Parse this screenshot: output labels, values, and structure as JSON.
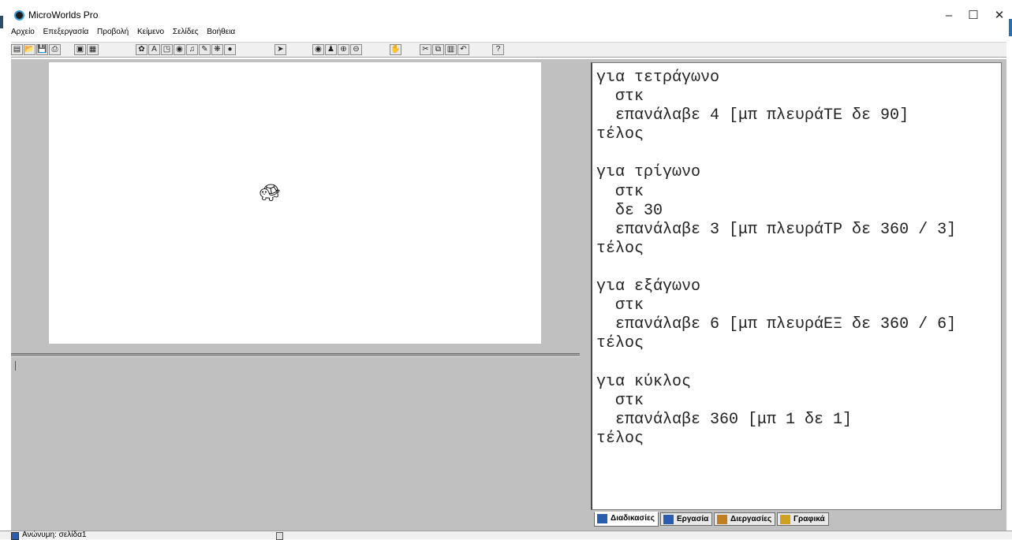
{
  "window": {
    "title": "MicroWorlds Pro",
    "minimize": "–",
    "maximize": "☐",
    "close": "✕"
  },
  "menu": [
    "Αρχείο",
    "Επεξεργασία",
    "Προβολή",
    "Κείμενο",
    "Σελίδες",
    "Βοήθεια"
  ],
  "toolbar": {
    "buttons": [
      {
        "name": "new-page-icon",
        "glyph": "▤"
      },
      {
        "name": "open-icon",
        "glyph": "📂"
      },
      {
        "name": "save-icon",
        "glyph": "💾"
      },
      {
        "name": "print-icon",
        "glyph": "⎙"
      },
      {
        "name": "show-page-icon",
        "glyph": "▣"
      },
      {
        "name": "show-sheet-icon",
        "glyph": "▦"
      },
      {
        "name": "new-turtle-icon",
        "glyph": "✿"
      },
      {
        "name": "text-box-icon",
        "glyph": "A"
      },
      {
        "name": "button-icon",
        "glyph": "◳"
      },
      {
        "name": "eye-icon",
        "glyph": "◉"
      },
      {
        "name": "music-icon",
        "glyph": "♫"
      },
      {
        "name": "paint-icon",
        "glyph": "✎"
      },
      {
        "name": "shapes-icon",
        "glyph": "❋"
      },
      {
        "name": "sound-icon",
        "glyph": "●"
      },
      {
        "name": "pointer-icon",
        "glyph": "➤"
      },
      {
        "name": "eye-tool-icon",
        "glyph": "◉"
      },
      {
        "name": "stamp-icon",
        "glyph": "♟"
      },
      {
        "name": "zoom-in-icon",
        "glyph": "⊕"
      },
      {
        "name": "zoom-out-icon",
        "glyph": "⊖"
      },
      {
        "name": "stop-icon",
        "glyph": "✋"
      },
      {
        "name": "cut-icon",
        "glyph": "✂"
      },
      {
        "name": "copy-icon",
        "glyph": "⧉"
      },
      {
        "name": "paste-icon",
        "glyph": "▥"
      },
      {
        "name": "undo-icon",
        "glyph": "↶"
      },
      {
        "name": "help-icon",
        "glyph": "?"
      }
    ]
  },
  "procedures": {
    "lines": [
      "για τετράγωνο",
      "  στκ",
      "  επανάλαβε 4 [μπ πλευράΤΕ δε 90]",
      "τέλος",
      "",
      "για τρίγωνο",
      "  στκ",
      "  δε 30",
      "  επανάλαβε 3 [μπ πλευράΤΡ δε 360 / 3]",
      "τέλος",
      "",
      "για εξάγωνο",
      "  στκ",
      "  επανάλαβε 6 [μπ πλευράΕΞ δε 360 / 6]",
      "τέλος",
      "",
      "για κύκλος",
      "  στκ",
      "  επανάλαβε 360 [μπ 1 δε 1]",
      "τέλος"
    ]
  },
  "tabs": [
    {
      "label": "Διαδικασίες",
      "icon": "procedures-icon",
      "active": true
    },
    {
      "label": "Εργασία",
      "icon": "project-icon",
      "active": false
    },
    {
      "label": "Διεργασίες",
      "icon": "processes-icon",
      "active": false
    },
    {
      "label": "Γραφικά",
      "icon": "graphics-icon",
      "active": false
    }
  ],
  "status": {
    "page_name": "Ανώνυμη: σελίδα1"
  },
  "colors": {
    "workspace_bg": "#c0c0c0",
    "canvas_bg": "#ffffff",
    "turtle": "#000000",
    "icon_accent": "#2a5db0"
  }
}
